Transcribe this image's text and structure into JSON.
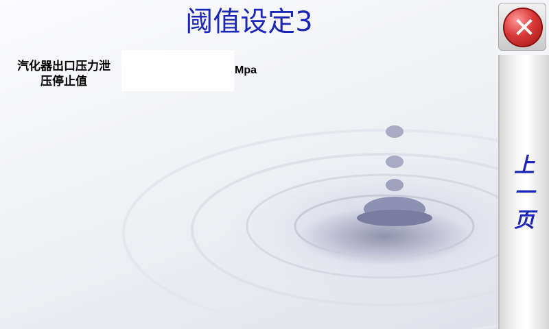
{
  "header": {
    "title": "阈值设定3"
  },
  "close_button": {
    "icon": "close-icon",
    "color": "#d93a3a"
  },
  "nav": {
    "prev_page_chars": [
      "上",
      "一",
      "页"
    ]
  },
  "parameter": {
    "label_line1": "汽化器出口压力泄",
    "label_line2": "压停止值",
    "value": "",
    "unit": "Mpa"
  },
  "colors": {
    "title": "#1c27b8",
    "prev_page": "#1c27b8"
  }
}
